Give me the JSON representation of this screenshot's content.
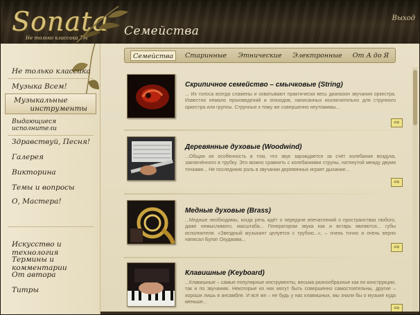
{
  "header": {
    "logo_text": "Sonata",
    "logo_tagline": "Не только классика ТМ",
    "section_title": "Семейства",
    "exit_label": "Выход"
  },
  "sidebar": {
    "items": [
      {
        "label": "Не только классика"
      },
      {
        "label": "Музыка Всем!"
      },
      {
        "label_line1": "Музыкальные",
        "label_line2": "инструменты"
      },
      {
        "label_line1": "Выдающиеся",
        "label_line2": "исполнители"
      },
      {
        "label": "Здравствуй, Песня!"
      },
      {
        "label": "Галерея"
      },
      {
        "label": "Викторина"
      },
      {
        "label": "Темы и вопросы"
      },
      {
        "label": "О, Мастера!"
      },
      {
        "label": "Искусство и технология"
      },
      {
        "label": "Термины и комментарии"
      },
      {
        "label": "От автора"
      },
      {
        "label": "Титры"
      }
    ]
  },
  "tabs": [
    {
      "label": "Семейства"
    },
    {
      "label": "Старинные"
    },
    {
      "label": "Этнические"
    },
    {
      "label": "Электронные"
    },
    {
      "label": "От А до Я"
    }
  ],
  "cards": [
    {
      "title": "Скрипичное семейство – смычковые (String)",
      "text": "... Их голоса всегда слажены и охватывают практически весь диапазон звучания оркестра. Известно немало произведений и эпизодов, написанных исключительно для струнного оркестра или группы. Струнные к тому же совершенно неутомимы...",
      "more_icon": "arrow-right-icon"
    },
    {
      "title": "Деревянные духовые (Woodwind)",
      "text": "...Общая их особенность в том, что звук зарождается за счёт колебания воздуха, заключённого в трубку. Это можно сравнить с колебаниями струны, натянутой между двумя точками... Не последнюю роль в звучании деревянных играет дыхание...",
      "more_icon": "arrow-right-icon"
    },
    {
      "title": "Медные духовые (Brass)",
      "text": "...Медные необходимы, когда речь идёт о передаче впечатлений о пространствах любого, даже немыслимого, масштаба... Генератором звука как и встарь являются... губы исполнителя. «Звездный музыкант целуется с трубою...», – очень точно и очень верно написал Булат Окуджава...",
      "more_icon": "arrow-right-icon"
    },
    {
      "title": "Клавишные (Keyboard)",
      "text": "...Клавишные – самые популярные инструменты, весьма разнообразные как по конструкции, так и по звучанию. Некоторые из них могут быть совершенно самостоятельны, другие – хороши лишь в ансамбле. И всё же – не будь у нас клавишных, мы знали бы о музыке куда меньше...",
      "more_icon": "arrow-right-icon"
    }
  ],
  "colors": {
    "header_dark": "#2a2216",
    "paper": "#e9e1c9",
    "more_button": "#efe38a",
    "text_muted": "#7a6a4a"
  }
}
